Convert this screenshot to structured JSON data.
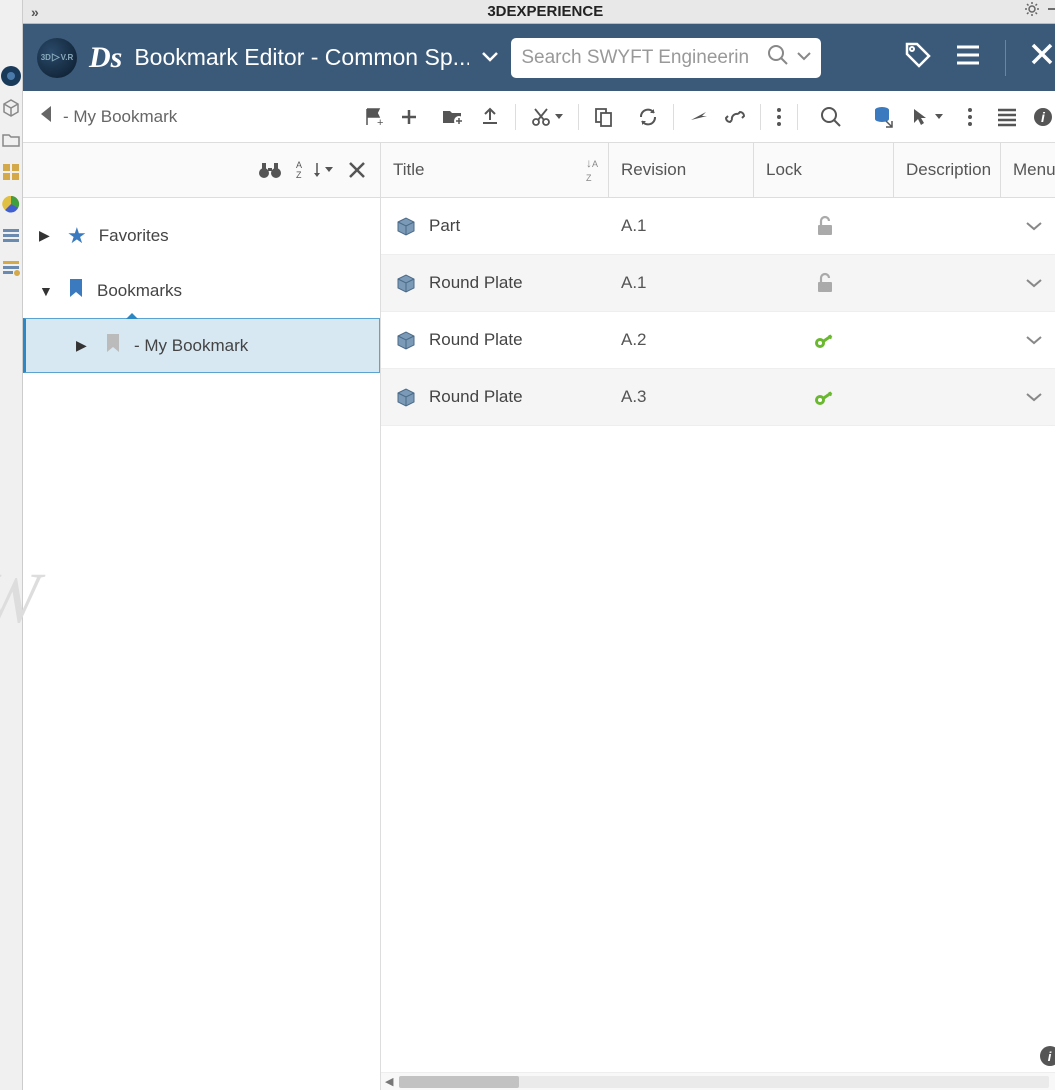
{
  "titlebar": {
    "title": "3DEXPERIENCE"
  },
  "app_header": {
    "compass_label": "3D ▷ V.R",
    "title": "Bookmark Editor - Common Sp...",
    "search_placeholder": "Search SWYFT Engineerin"
  },
  "toolbar": {
    "back_label": "- My Bookmark"
  },
  "tree": {
    "favorites_label": "Favorites",
    "bookmarks_label": "Bookmarks",
    "mybookmark_label": "- My Bookmark"
  },
  "table": {
    "headers": {
      "title": "Title",
      "revision": "Revision",
      "lock": "Lock",
      "description": "Description",
      "menu": "Menu"
    },
    "rows": [
      {
        "title": "Part",
        "revision": "A.1",
        "lock": "unlocked",
        "description": ""
      },
      {
        "title": "Round Plate",
        "revision": "A.1",
        "lock": "unlocked",
        "description": ""
      },
      {
        "title": "Round Plate",
        "revision": "A.2",
        "lock": "key",
        "description": ""
      },
      {
        "title": "Round Plate",
        "revision": "A.3",
        "lock": "key",
        "description": ""
      }
    ]
  }
}
